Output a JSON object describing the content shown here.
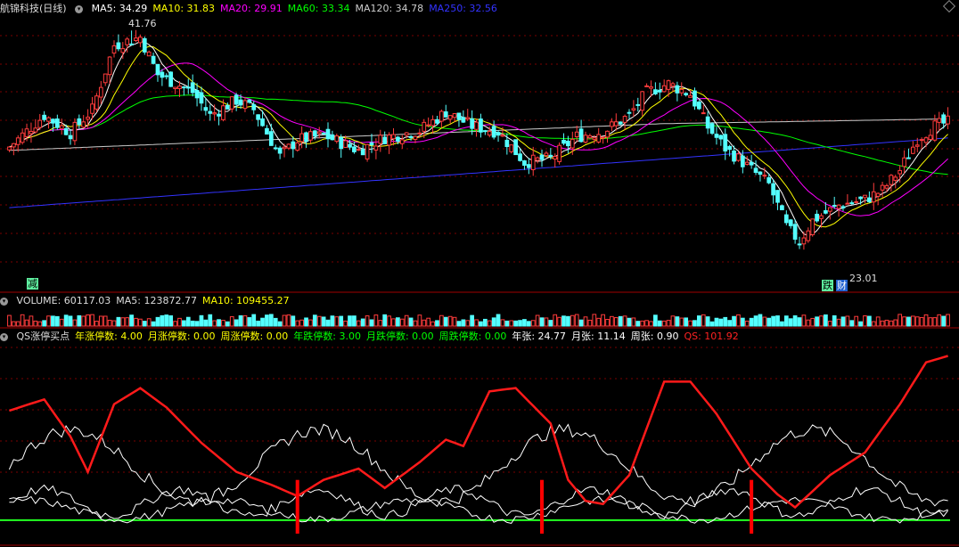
{
  "header": {
    "stock": "航锦科技(日线)",
    "ma_items": [
      {
        "label": "MA5: 34.29",
        "color": "#ffffff"
      },
      {
        "label": "MA10: 31.83",
        "color": "#ffff00"
      },
      {
        "label": "MA20: 29.91",
        "color": "#ff00ff"
      },
      {
        "label": "MA60: 33.34",
        "color": "#00ff00"
      },
      {
        "label": "MA120: 34.78",
        "color": "#cccccc"
      },
      {
        "label": "MA250: 32.56",
        "color": "#3333ff"
      }
    ]
  },
  "volume_header": [
    {
      "label": "VOLUME: 60117.03",
      "color": "#dddddd"
    },
    {
      "label": "MA5: 123872.77",
      "color": "#dddddd"
    },
    {
      "label": "MA10: 109455.27",
      "color": "#ffff00"
    }
  ],
  "indicator_header": [
    {
      "label": "QS涨停买点",
      "color": "#dddddd"
    },
    {
      "label": "年涨停数: 4.00",
      "color": "#ffff00"
    },
    {
      "label": "月涨停数: 0.00",
      "color": "#ffff00"
    },
    {
      "label": "周涨停数: 0.00",
      "color": "#ffff00"
    },
    {
      "label": "年跌停数: 3.00",
      "color": "#00ff00"
    },
    {
      "label": "月跌停数: 0.00",
      "color": "#00ff00"
    },
    {
      "label": "周跌停数: 0.00",
      "color": "#00ff00"
    },
    {
      "label": "年张: 24.77",
      "color": "#ffffff"
    },
    {
      "label": "月张: 11.14",
      "color": "#ffffff"
    },
    {
      "label": "周张: 0.90",
      "color": "#ffffff"
    },
    {
      "label": "QS: 101.92",
      "color": "#ff2222"
    }
  ],
  "annotations": {
    "high_label": "41.76",
    "low_label": "23.01",
    "tag_left": "减",
    "tag_die": "跌",
    "tag_cai": "财"
  },
  "colors": {
    "up": "#ff3c3c",
    "down": "#54ffff",
    "grid": "#7a0000",
    "qs": "#ff1a1a",
    "signal": "#ff0000"
  },
  "chart_data": {
    "type": "candlestick",
    "price_range": [
      23.01,
      41.76
    ],
    "candles": [],
    "ma5": [],
    "volume": [],
    "qs": [],
    "buy_signal_bars": [
      66,
      122,
      170
    ]
  }
}
